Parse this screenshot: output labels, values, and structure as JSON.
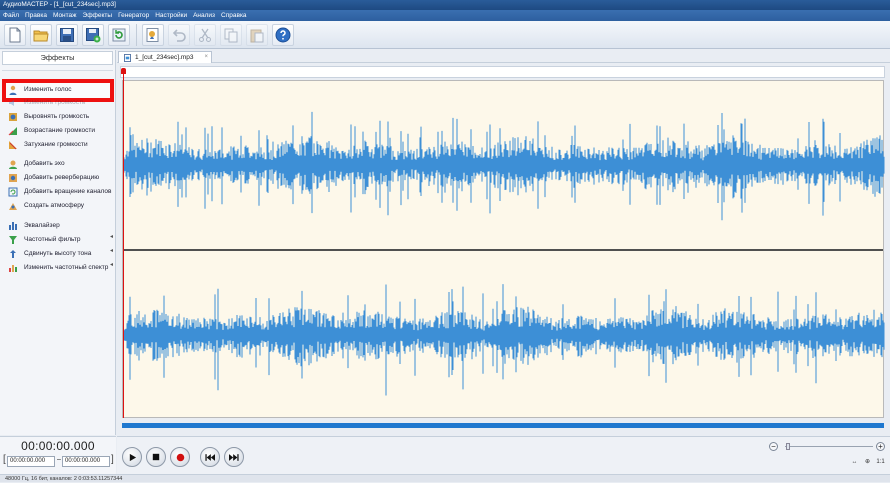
{
  "window": {
    "title": "АудиоМАСТЕР - [1_[cut_234sec].mp3]"
  },
  "menu": [
    "Файл",
    "Правка",
    "Монтаж",
    "Эффекты",
    "Генератор",
    "Настройки",
    "Анализ",
    "Справка"
  ],
  "toolbar": {
    "buttons": [
      "new-file-icon",
      "open-folder-icon",
      "save-icon",
      "save-as-icon",
      "refresh-icon",
      "record-voice-icon",
      "undo-icon",
      "cut-icon",
      "copy-icon",
      "paste-icon",
      "help-icon"
    ]
  },
  "effects_panel": {
    "header": "Эффекты",
    "items": [
      {
        "label": "Изменить голос",
        "icon": "voice-icon",
        "highlighted": true
      },
      {
        "label": "Изменить громкость",
        "icon": "volume-icon"
      },
      {
        "label": "Выровнять громкость",
        "icon": "level-icon"
      },
      {
        "label": "Возрастание громкости",
        "icon": "fade-in-icon"
      },
      {
        "label": "Затухание громкости",
        "icon": "fade-out-icon"
      },
      {
        "label": "Добавить эхо",
        "icon": "echo-icon"
      },
      {
        "label": "Добавить реверберацию",
        "icon": "reverb-icon"
      },
      {
        "label": "Добавить вращение каналов",
        "icon": "rotate-channels-icon"
      },
      {
        "label": "Создать атмосферу",
        "icon": "atmosphere-icon"
      },
      {
        "label": "Эквалайзер",
        "icon": "equalizer-icon"
      },
      {
        "label": "Частотный фильтр",
        "icon": "filter-icon",
        "submenu": true
      },
      {
        "label": "Сдвинуть высоту тона",
        "icon": "pitch-icon",
        "submenu": true
      },
      {
        "label": "Изменить частотный спектр",
        "icon": "spectrum-icon",
        "submenu": true
      }
    ]
  },
  "document": {
    "tab_label": "1_[cut_234sec].mp3",
    "channels": 2
  },
  "time": {
    "current": "00:00:00.000",
    "selection_start": "00:00:00.000",
    "selection_end": "00:00:00.000"
  },
  "transport": [
    "play-icon",
    "stop-icon",
    "record-icon",
    "rewind-icon",
    "fast-forward-icon"
  ],
  "zoom": {
    "minus": "−",
    "plus": "+",
    "level": 0.02
  },
  "status": {
    "text": "48000 Гц, 16 бит, каналов: 2   0:03:53.11257344"
  },
  "colors": {
    "waveform": "#3d8fd6",
    "wave_bg": "#fdf8ea",
    "highlight": "#ee1111",
    "scrollbar": "#1f78cf"
  }
}
